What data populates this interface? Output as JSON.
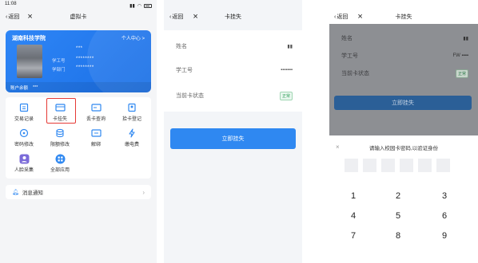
{
  "screen1": {
    "status_time": "11:08",
    "nav_back": "返回",
    "nav_title": "虚拟卡",
    "card": {
      "school": "湖南科技学院",
      "user_center": "个人中心 >",
      "name_dots": "***",
      "id_label": "学工号",
      "id_dots": "********",
      "dept_label": "学部门",
      "dept_dots": "********",
      "balance_label": "账户余额",
      "balance_value": "***"
    },
    "grid": [
      {
        "label": "交易记录",
        "icon": "receipt-icon"
      },
      {
        "label": "卡挂失",
        "icon": "card-lock-icon"
      },
      {
        "label": "丢卡查询",
        "icon": "card-search-icon"
      },
      {
        "label": "拾卡登记",
        "icon": "card-register-icon"
      },
      {
        "label": "密码修改",
        "icon": "key-icon"
      },
      {
        "label": "限额修改",
        "icon": "database-icon"
      },
      {
        "label": "解绑",
        "icon": "unbind-icon"
      },
      {
        "label": "缴电费",
        "icon": "lightning-icon"
      },
      {
        "label": "人脸采集",
        "icon": "face-icon"
      },
      {
        "label": "全部应用",
        "icon": "apps-icon"
      }
    ],
    "notice": "消息通知"
  },
  "screen2": {
    "nav_back": "返回",
    "nav_title": "卡挂失",
    "rows": [
      {
        "label": "姓名",
        "value": "▮▮"
      },
      {
        "label": "学工号",
        "value": "▪▪▪▪▪▪▪"
      },
      {
        "label": "当前卡状态",
        "badge": "正常"
      }
    ],
    "button": "立即挂失"
  },
  "screen3": {
    "nav_back": "返回",
    "nav_title": "卡挂失",
    "rows": [
      {
        "label": "姓名",
        "value": "▮▮"
      },
      {
        "label": "学工号",
        "value": "FW ▪▪▪▪"
      },
      {
        "label": "当前卡状态",
        "badge": "正常"
      }
    ],
    "button": "立即挂失",
    "prompt": "请输入校园卡密码,以验证身份",
    "keys": [
      "1",
      "2",
      "3",
      "4",
      "5",
      "6",
      "7",
      "8",
      "9"
    ]
  },
  "colors": {
    "primary": "#2f88f1",
    "card": "#1a6fe6",
    "highlight": "#e53935",
    "badge": "#2e9e58"
  }
}
